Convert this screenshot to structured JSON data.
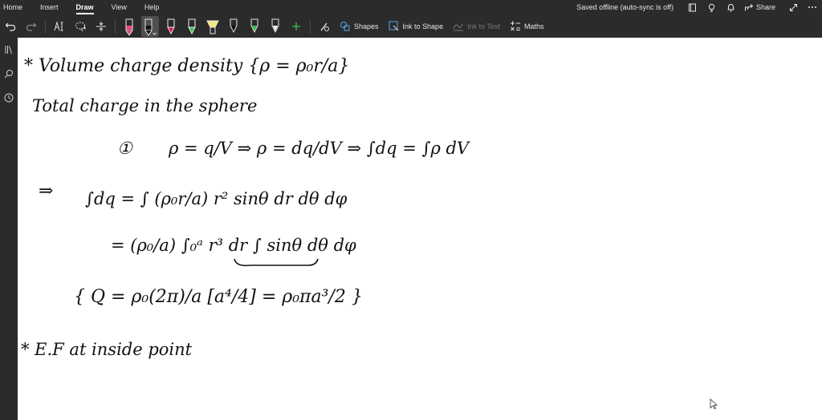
{
  "menu": {
    "items": [
      {
        "label": "Home"
      },
      {
        "label": "Insert"
      },
      {
        "label": "Draw"
      },
      {
        "label": "View"
      },
      {
        "label": "Help"
      }
    ],
    "active": "Draw"
  },
  "status": {
    "sync_text": "Saved offline (auto-sync is off)",
    "share_label": "Share"
  },
  "toolbar": {
    "shapes_label": "Shapes",
    "ink_to_shape_label": "Ink to Shape",
    "ink_to_text_label": "Ink to Text",
    "maths_label": "Maths",
    "pens": [
      {
        "icon": "pen-icon",
        "color": "#e64980"
      },
      {
        "icon": "pen-icon",
        "color": "#111111",
        "selected": true
      },
      {
        "icon": "pen-icon",
        "color": "#e0115f"
      },
      {
        "icon": "pen-icon",
        "color": "#38c24a"
      },
      {
        "icon": "highlighter-icon",
        "color": "#f5e67a"
      },
      {
        "icon": "pen-icon",
        "color": "#111111"
      },
      {
        "icon": "pen-icon",
        "color": "#38c24a"
      },
      {
        "icon": "pen-icon",
        "color": "#eeeeee"
      }
    ]
  },
  "notes": {
    "line1": "* Volume charge density {ρ = ρ₀r/a}",
    "line2": "Total charge in the sphere",
    "line3_num": "①",
    "line3": "ρ = q/V   ⇒   ρ = dq/dV   ⇒   ∫dq = ∫ρ dV",
    "line4_arrow": "⇒",
    "line4": "∫dq = ∫ (ρ₀r/a) r² sinθ dr dθ dφ",
    "line5": "= (ρ₀/a) ∫₀ᵃ r³ dr ∫ sinθ dθ dφ",
    "line6": "{ Q = ρ₀(2π)/a [a⁴/4] = ρ₀πa³/2 }",
    "line7": "* E.F at inside point"
  },
  "colors": {
    "app_bg": "#2b2b2b",
    "page_bg": "#ffffff",
    "ink": "#111111"
  }
}
